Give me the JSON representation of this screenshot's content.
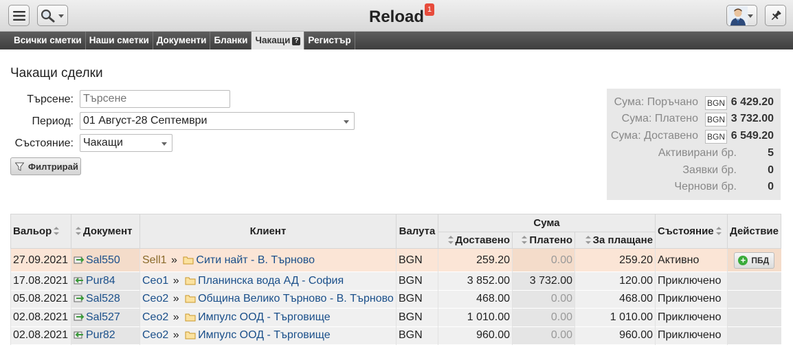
{
  "app": {
    "title": "Reload",
    "notification_count": "1"
  },
  "tabs": [
    {
      "label": "Всички сметки"
    },
    {
      "label": "Наши сметки"
    },
    {
      "label": "Документи"
    },
    {
      "label": "Бланки"
    },
    {
      "label": "Чакащи",
      "help": "?"
    },
    {
      "label": "Регистър"
    }
  ],
  "page": {
    "title": "Чакащи сделки"
  },
  "filters": {
    "search_label": "Търсене:",
    "search_placeholder": "Търсене",
    "period_label": "Период:",
    "period_value": "01 Август-28 Септември",
    "state_label": "Състояние:",
    "state_value": "Чакащи",
    "filter_button": "Филтрирай"
  },
  "summary": {
    "rows": [
      {
        "label": "Сума: Поръчано",
        "currency": "BGN",
        "value": "6 429.20"
      },
      {
        "label": "Сума: Платено",
        "currency": "BGN",
        "value": "3 732.00"
      },
      {
        "label": "Сума: Доставено",
        "currency": "BGN",
        "value": "6 549.20"
      },
      {
        "label": "Активирани бр.",
        "value": "5"
      },
      {
        "label": "Заявки бр.",
        "value": "0"
      },
      {
        "label": "Чернови бр.",
        "value": "0"
      }
    ]
  },
  "table": {
    "headers": {
      "date": "Вальор",
      "document": "Документ",
      "client": "Клиент",
      "currency": "Валута",
      "amount": "Сума",
      "delivered": "Доставено",
      "paid": "Платено",
      "to_pay": "За плащане",
      "state": "Състояние",
      "action": "Действие"
    },
    "rows": [
      {
        "date": "27.09.2021",
        "doc": "Sal550",
        "agent": "Sell1",
        "sep": "»",
        "client": "Сити найт - В. Търново",
        "currency": "BGN",
        "delivered": "259.20",
        "paid": "0.00",
        "to_pay": "259.20",
        "state": "Активно",
        "action": "ПБД"
      },
      {
        "date": "17.08.2021",
        "doc": "Pur84",
        "agent": "Ceo1",
        "sep": "»",
        "client": "Планинска вода АД - София",
        "currency": "BGN",
        "delivered": "3 852.00",
        "paid": "3 732.00",
        "to_pay": "120.00",
        "state": "Приключено",
        "action": ""
      },
      {
        "date": "05.08.2021",
        "doc": "Sal528",
        "agent": "Ceo2",
        "sep": "»",
        "client": "Община Велико Търново - В. Търново",
        "currency": "BGN",
        "delivered": "468.00",
        "paid": "0.00",
        "to_pay": "468.00",
        "state": "Приключено",
        "action": ""
      },
      {
        "date": "02.08.2021",
        "doc": "Sal527",
        "agent": "Ceo2",
        "sep": "»",
        "client": "Импулс ООД - Търговище",
        "currency": "BGN",
        "delivered": "1 010.00",
        "paid": "0.00",
        "to_pay": "1 010.00",
        "state": "Приключено",
        "action": ""
      },
      {
        "date": "02.08.2021",
        "doc": "Pur82",
        "agent": "Ceo2",
        "sep": "»",
        "client": "Импулс ООД - Търговище",
        "currency": "BGN",
        "delivered": "960.00",
        "paid": "0.00",
        "to_pay": "960.00",
        "state": "Приключено",
        "action": ""
      }
    ]
  }
}
